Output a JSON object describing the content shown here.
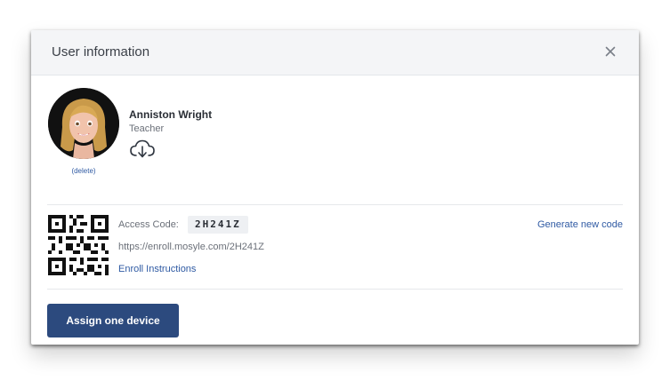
{
  "modal": {
    "title": "User information",
    "close_icon": "close-icon"
  },
  "user": {
    "name": "Anniston Wright",
    "role": "Teacher",
    "delete_label": "(delete)",
    "avatar_icon": "memoji-avatar",
    "download_icon": "cloud-download-icon"
  },
  "enrollment": {
    "access_code_label": "Access Code:",
    "access_code": "2H241Z",
    "url": "https://enroll.mosyle.com/2H241Z",
    "instructions_label": "Enroll Instructions",
    "generate_label": "Generate new code",
    "qr_icon": "qr-code-icon"
  },
  "footer": {
    "assign_label": "Assign one device"
  },
  "colors": {
    "primary": "#2c4a7e",
    "link": "#2f5aa3",
    "header_bg": "#f4f5f7"
  }
}
